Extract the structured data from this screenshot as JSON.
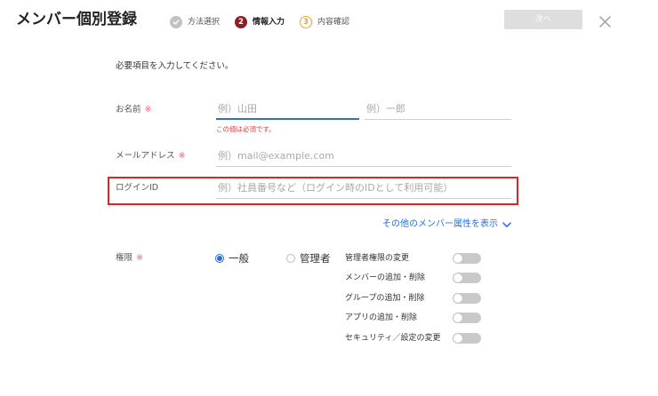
{
  "header": {
    "title": "メンバー個別登録",
    "steps": [
      {
        "label": "方法選択",
        "state": "done",
        "icon": "check-circle-icon"
      },
      {
        "number": "2",
        "label": "情報入力",
        "state": "current"
      },
      {
        "number": "3",
        "label": "内容確認",
        "state": "upcoming"
      }
    ],
    "next_button": {
      "label": "次へ",
      "disabled": true
    },
    "close_icon": "close-icon"
  },
  "form": {
    "instruction": "必要項目を入力してください。",
    "required_mark": "※",
    "name": {
      "label": "お名前",
      "last_name": {
        "placeholder": "例）山田",
        "focused": true
      },
      "first_name": {
        "placeholder": "例）一郎",
        "focused": false
      },
      "error": "この値は必須です。"
    },
    "email": {
      "label": "メールアドレス",
      "placeholder": "例）mail@example.com"
    },
    "login_id": {
      "label": "ログインID",
      "placeholder": "例）社員番号など（ログイン時のIDとして利用可能）",
      "highlighted": true
    },
    "more_attributes": {
      "label": "その他のメンバー属性を表示",
      "icon": "chevron-down-icon"
    },
    "permission": {
      "label": "権限",
      "options": [
        {
          "label": "一般",
          "checked": true
        },
        {
          "label": "管理者",
          "checked": false
        }
      ],
      "toggles": [
        {
          "label": "管理者権限の変更",
          "on": false
        },
        {
          "label": "メンバーの追加・削除",
          "on": false
        },
        {
          "label": "グループの追加・削除",
          "on": false
        },
        {
          "label": "アプリの追加・削除",
          "on": false
        },
        {
          "label": "セキュリティ／設定の変更",
          "on": false
        }
      ]
    }
  },
  "colors": {
    "text": "#333333",
    "placeholder": "#a9a9a9",
    "accent": "#2b6fd6",
    "step_current": "#8f1d24",
    "step_upcoming": "#e6a63c",
    "step_done": "#c2c2c2",
    "error": "#e0383e",
    "required": "#e66a85",
    "highlight": "#e02424",
    "toggle_off": "#c9c9c9",
    "button_disabled": "#dedede"
  }
}
